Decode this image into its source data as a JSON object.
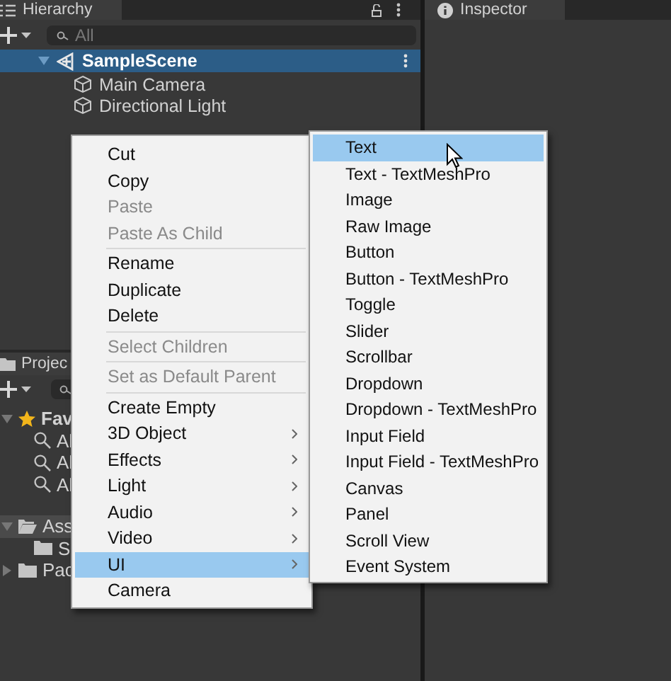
{
  "hierarchy": {
    "tab": "Hierarchy",
    "search": {
      "placeholder": "All"
    },
    "tree": [
      {
        "label": "SampleScene",
        "kind": "scene",
        "selected": true,
        "expanded": true,
        "children": [
          {
            "label": "Main Camera",
            "kind": "object",
            "selected": false
          },
          {
            "label": "Directional Light",
            "kind": "object",
            "selected": false
          }
        ]
      }
    ]
  },
  "inspector": {
    "tab": "Inspector"
  },
  "project": {
    "tab": "Projec",
    "tree": [
      {
        "label": "Fav",
        "kind": "favorites",
        "expanded": true,
        "children": [
          {
            "label": "Al",
            "kind": "search"
          },
          {
            "label": "Al",
            "kind": "search"
          },
          {
            "label": "Al",
            "kind": "search"
          }
        ]
      },
      {
        "label": "Ass",
        "kind": "folder",
        "expanded": true,
        "selected": true,
        "children": [
          {
            "label": "S",
            "kind": "folder"
          }
        ]
      },
      {
        "label": "Pac",
        "kind": "folder",
        "expanded": false,
        "selected": false
      }
    ]
  },
  "context_menu": [
    [
      {
        "label": "Cut",
        "disabled": false,
        "submenu": false,
        "selected": false
      },
      {
        "label": "Copy",
        "disabled": false,
        "submenu": false,
        "selected": false
      },
      {
        "label": "Paste",
        "disabled": true,
        "submenu": false,
        "selected": false
      },
      {
        "label": "Paste As Child",
        "disabled": true,
        "submenu": false,
        "selected": false
      }
    ],
    [
      {
        "label": "Rename",
        "disabled": false,
        "submenu": false,
        "selected": false
      },
      {
        "label": "Duplicate",
        "disabled": false,
        "submenu": false,
        "selected": false
      },
      {
        "label": "Delete",
        "disabled": false,
        "submenu": false,
        "selected": false
      }
    ],
    [
      {
        "label": "Select Children",
        "disabled": true,
        "submenu": false,
        "selected": false
      }
    ],
    [
      {
        "label": "Set as Default Parent",
        "disabled": true,
        "submenu": false,
        "selected": false
      }
    ],
    [
      {
        "label": "Create Empty",
        "disabled": false,
        "submenu": false,
        "selected": false
      },
      {
        "label": "3D Object",
        "disabled": false,
        "submenu": true,
        "selected": false
      },
      {
        "label": "Effects",
        "disabled": false,
        "submenu": true,
        "selected": false
      },
      {
        "label": "Light",
        "disabled": false,
        "submenu": true,
        "selected": false
      },
      {
        "label": "Audio",
        "disabled": false,
        "submenu": true,
        "selected": false
      },
      {
        "label": "Video",
        "disabled": false,
        "submenu": true,
        "selected": false
      },
      {
        "label": "UI",
        "disabled": false,
        "submenu": true,
        "selected": true
      },
      {
        "label": "Camera",
        "disabled": false,
        "submenu": false,
        "selected": false
      }
    ]
  ],
  "submenu": [
    {
      "label": "Text",
      "selected": true
    },
    {
      "label": "Text - TextMeshPro",
      "selected": false
    },
    {
      "label": "Image",
      "selected": false
    },
    {
      "label": "Raw Image",
      "selected": false
    },
    {
      "label": "Button",
      "selected": false
    },
    {
      "label": "Button - TextMeshPro",
      "selected": false
    },
    {
      "label": "Toggle",
      "selected": false
    },
    {
      "label": "Slider",
      "selected": false
    },
    {
      "label": "Scrollbar",
      "selected": false
    },
    {
      "label": "Dropdown",
      "selected": false
    },
    {
      "label": "Dropdown - TextMeshPro",
      "selected": false
    },
    {
      "label": "Input Field",
      "selected": false
    },
    {
      "label": "Input Field - TextMeshPro",
      "selected": false
    },
    {
      "label": "Canvas",
      "selected": false
    },
    {
      "label": "Panel",
      "selected": false
    },
    {
      "label": "Scroll View",
      "selected": false
    },
    {
      "label": "Event System",
      "selected": false
    }
  ]
}
